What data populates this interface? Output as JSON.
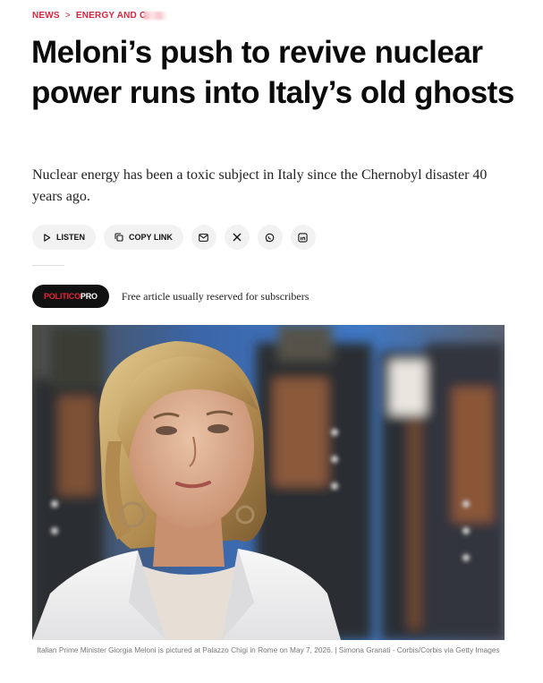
{
  "breadcrumb": {
    "section": "NEWS",
    "separator": ">",
    "subsection": "ENERGY AND C"
  },
  "article": {
    "title": "Meloni’s push to revive nuclear power runs into Italy’s old ghosts",
    "dek": "Nuclear energy has been a toxic subject in Italy since the Chernobyl disaster 40 years ago."
  },
  "share": {
    "listen_label": "LISTEN",
    "copy_link_label": "COPY LINK",
    "icons": [
      "email-icon",
      "x-icon",
      "whatsapp-icon",
      "linkedin-icon"
    ]
  },
  "pro": {
    "badge_brand": "POLITICO",
    "badge_suffix": "PRO",
    "note": "Free article usually reserved for subscribers"
  },
  "photo": {
    "caption": "Italian Prime Minister Giorgia Meloni is pictured at Palazzo Chigi in Rome on May 7, 2026. | Simona Granati - Corbis/Corbis via Getty Images"
  },
  "colors": {
    "accent": "#d7263d",
    "pill_bg": "#f2f2f2",
    "badge_bg": "#111111"
  }
}
